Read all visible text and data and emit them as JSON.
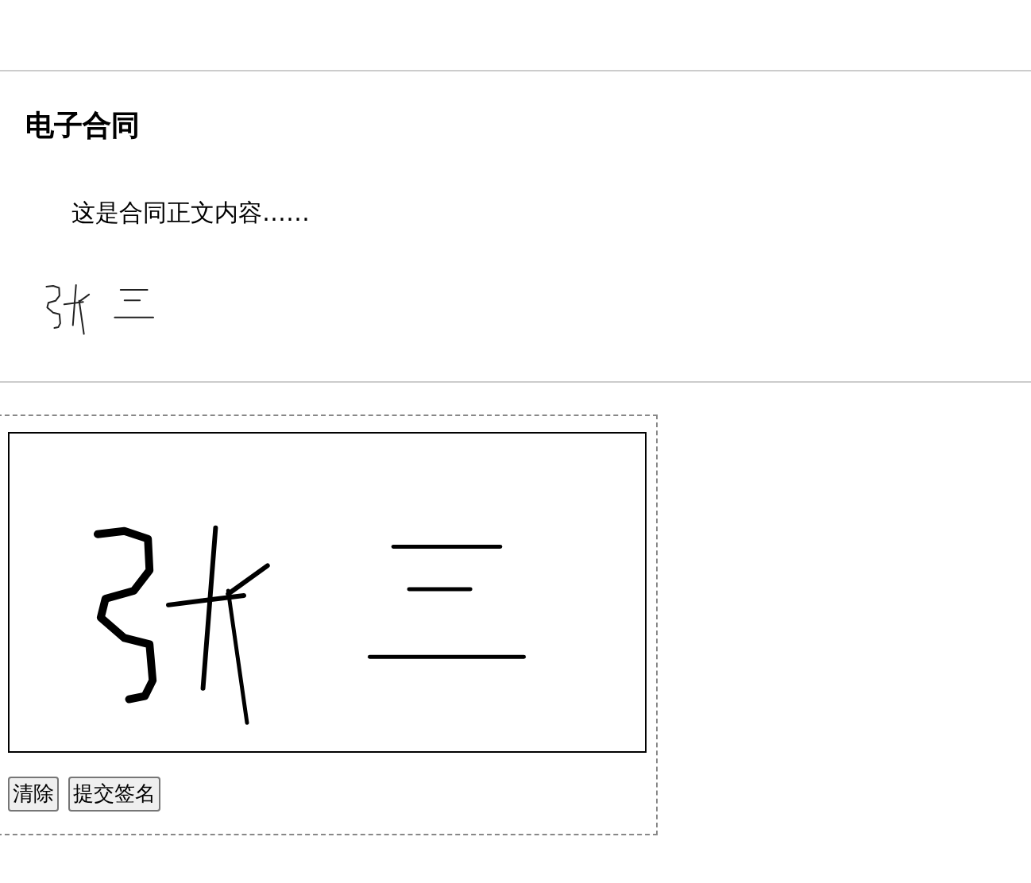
{
  "contract": {
    "title": "电子合同",
    "body": "这是合同正文内容……"
  },
  "buttons": [
    {
      "label": "清除"
    },
    {
      "label": "提交签名"
    }
  ]
}
